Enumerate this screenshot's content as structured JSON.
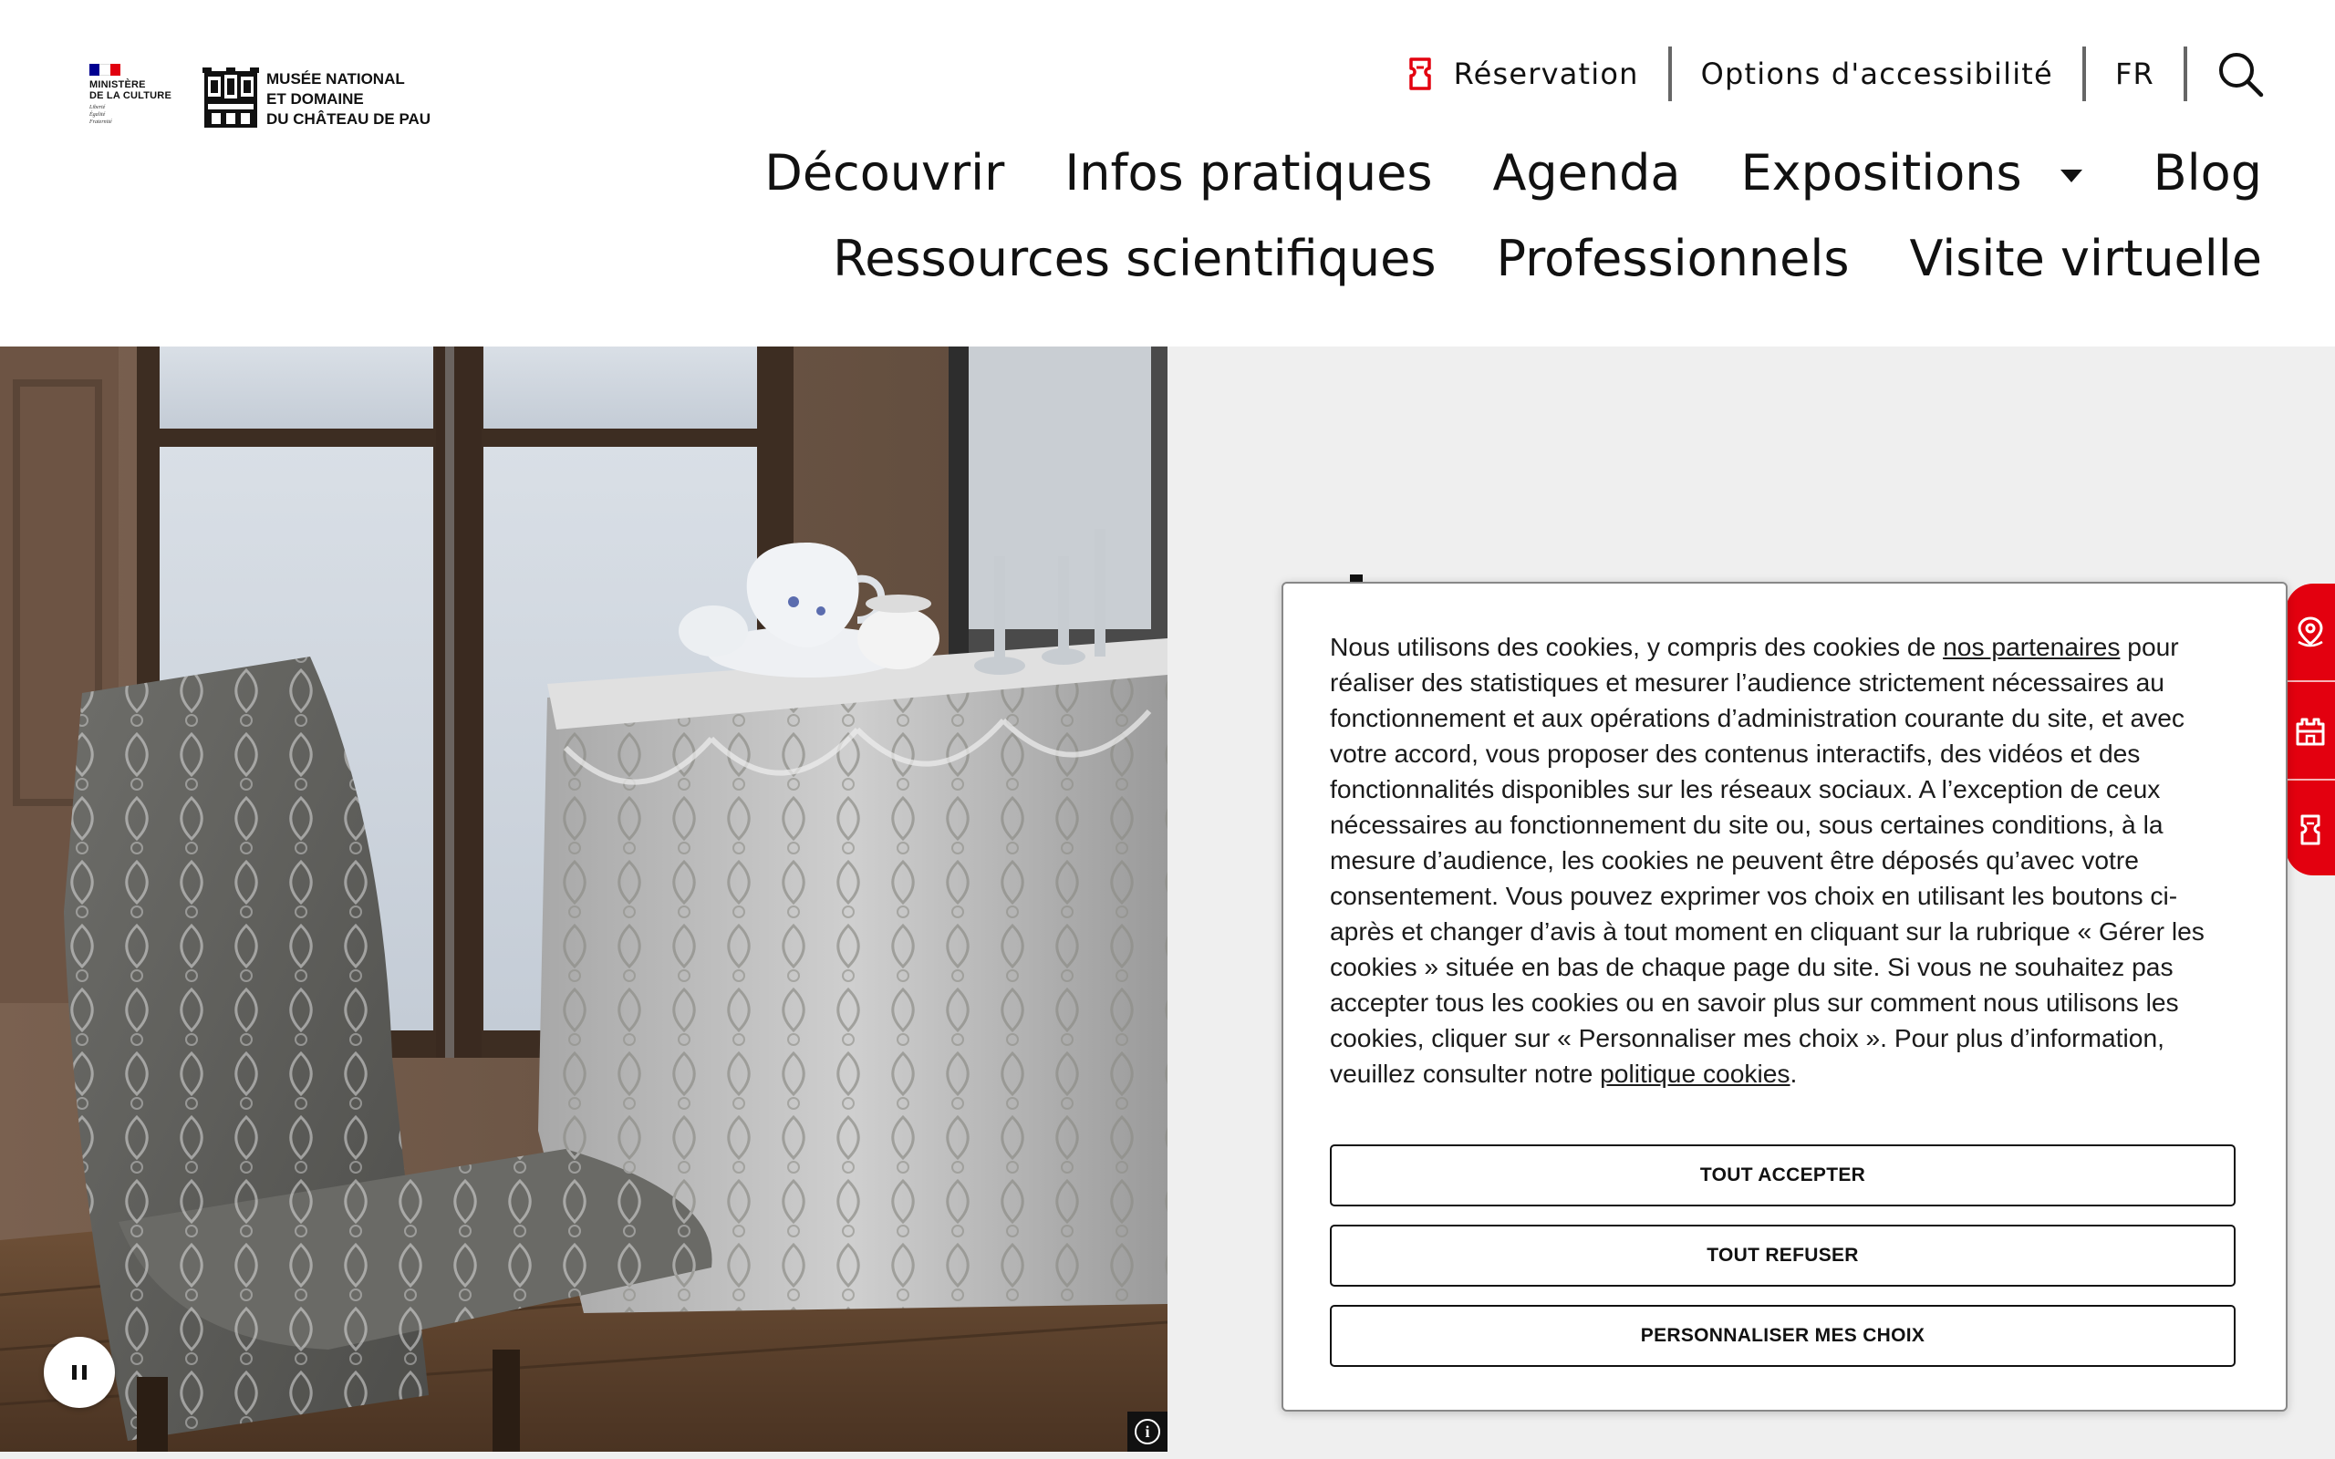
{
  "header": {
    "ministere": {
      "lines": [
        "MINISTÈRE",
        "DE LA CULTURE"
      ],
      "motto": [
        "Liberté",
        "Égalité",
        "Fraternité"
      ]
    },
    "musee": {
      "lines": [
        "MUSÉE NATIONAL",
        "ET DOMAINE",
        "DU CHÂTEAU DE PAU"
      ]
    },
    "utility": {
      "reservation": "Réservation",
      "accessibility": "Options d'accessibilité",
      "language": "FR",
      "search_icon": "search-icon"
    },
    "nav_row1": [
      "Découvrir",
      "Infos pratiques",
      "Agenda",
      "Expositions",
      "Blog"
    ],
    "nav_row2": [
      "Ressources scientifiques",
      "Professionnels",
      "Visite virtuelle"
    ]
  },
  "hero": {
    "pause_icon": "pause-icon",
    "info_icon": "info-icon",
    "info_glyph": "i",
    "side_tabs": [
      "location-pin-icon",
      "castle-icon",
      "ticket-icon"
    ]
  },
  "cookie": {
    "text_1": "Nous utilisons des cookies, y compris des cookies de ",
    "partners_link": "nos partenaires",
    "text_2": " pour réaliser des statistiques et mesurer l’audience strictement nécessaires au fonctionnement et aux opérations d’administration courante du site, et avec votre accord, vous proposer des contenus interactifs, des vidéos et des fonctionnalités disponibles sur les réseaux sociaux. A l’exception de ceux nécessaires au fonctionnement du site ou, sous certaines conditions, à la mesure d’audience, les cookies ne peuvent être déposés qu’avec votre consentement. Vous pouvez exprimer vos choix en utilisant les boutons ci-après et changer d’avis à tout moment en cliquant sur la rubrique « Gérer les cookies » située en bas de chaque page du site. Si vous ne souhaitez pas accepter tous les cookies ou en savoir plus sur comment nous utilisons les cookies, cliquer sur « Personnaliser mes choix ». Pour plus d’information, veuillez consulter notre ",
    "policy_link": "politique cookies",
    "text_3": ".",
    "accept_all": "TOUT ACCEPTER",
    "refuse_all": "TOUT REFUSER",
    "customize": "PERSONNALISER MES CHOIX"
  },
  "colors": {
    "accent_red": "#e3000f",
    "text": "#111111",
    "hero_bg": "#efefef",
    "flag_blue": "#000091",
    "flag_red": "#e1000f"
  }
}
